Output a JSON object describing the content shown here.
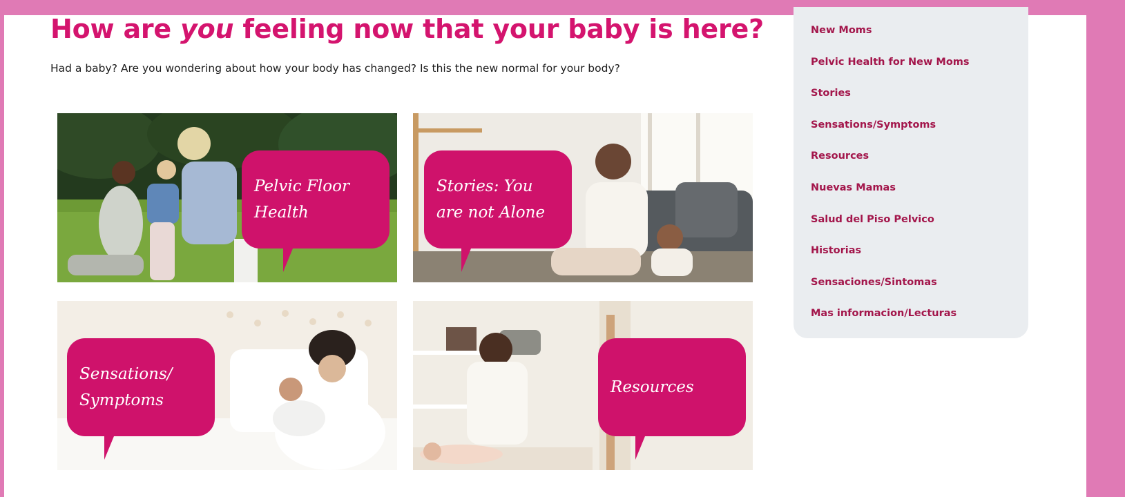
{
  "page": {
    "headline_part1": "How are ",
    "headline_emphasis": "you",
    "headline_part2": " feeling now that your baby is here?",
    "intro": "Had a baby? Are you wondering about how your body has changed? Is this the new normal for your body?"
  },
  "tiles": [
    {
      "label": "Pelvic Floor\nHealth"
    },
    {
      "label": "Stories: You\nare not Alone"
    },
    {
      "label": "Sensations/\nSymptoms"
    },
    {
      "label": "Resources"
    }
  ],
  "sidebar": {
    "items": [
      {
        "label": "New Moms"
      },
      {
        "label": "Pelvic Health for New Moms"
      },
      {
        "label": "Stories"
      },
      {
        "label": "Sensations/Symptoms"
      },
      {
        "label": "Resources"
      },
      {
        "label": "Nuevas Mamas"
      },
      {
        "label": "Salud del Piso Pelvico"
      },
      {
        "label": "Historias"
      },
      {
        "label": "Sensaciones/Sintomas"
      },
      {
        "label": "Mas informacion/Lecturas"
      }
    ]
  },
  "colors": {
    "accent": "#d4146e",
    "bubble": "#cf126b",
    "sidebar_link": "#a3164b",
    "frame": "#e07ab5",
    "sidebar_bg": "#eaedf0"
  }
}
